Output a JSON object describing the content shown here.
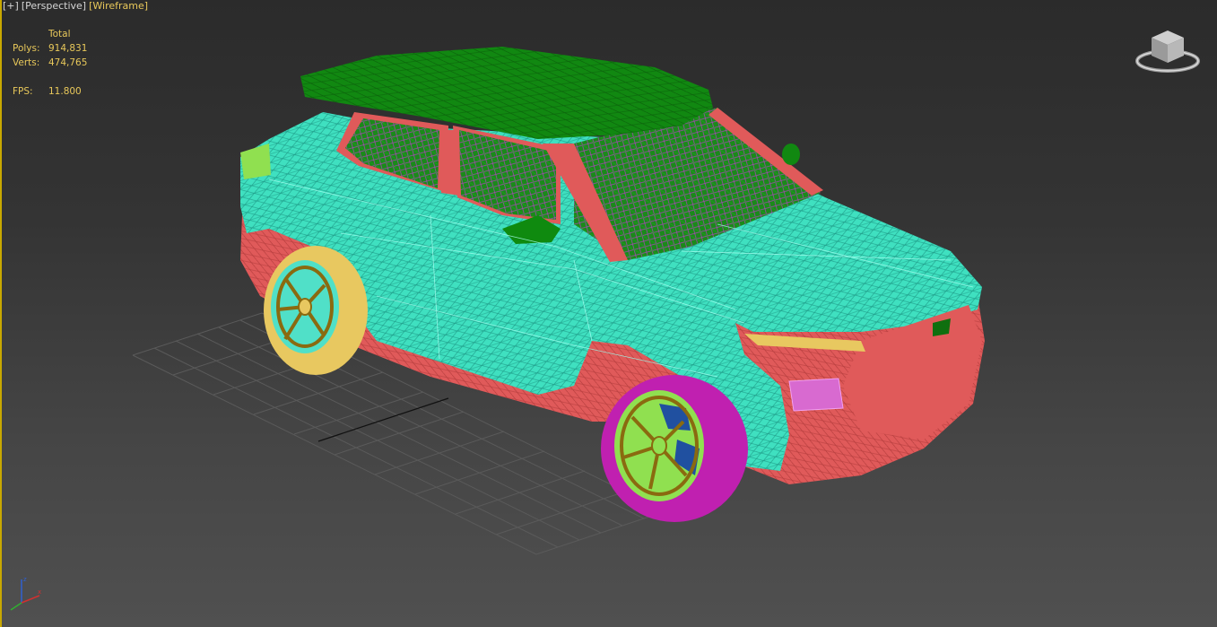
{
  "viewport": {
    "label_plus": "[+]",
    "label_view": "[Perspective]",
    "label_mode": "[Wireframe]"
  },
  "stats": {
    "header": "Total",
    "polys_label": "Polys:",
    "polys_value": "914,831",
    "verts_label": "Verts:",
    "verts_value": "474,765",
    "fps_label": "FPS:",
    "fps_value": "11.800"
  },
  "viewcube": {
    "icon": "viewcube-icon"
  },
  "axis": {
    "x": "x",
    "z": "z",
    "colors": {
      "x": "#d03030",
      "y": "#30b030",
      "z": "#3060d0"
    }
  },
  "colors": {
    "accent": "#e8c85a",
    "body": "#3fe0c0",
    "trim": "#e05a5a",
    "roof": "#118811",
    "tire_front": "#c020b0",
    "tire_rear": "#e8c860",
    "rim_front": "#90e050",
    "rim_rear": "#50e0c8"
  }
}
